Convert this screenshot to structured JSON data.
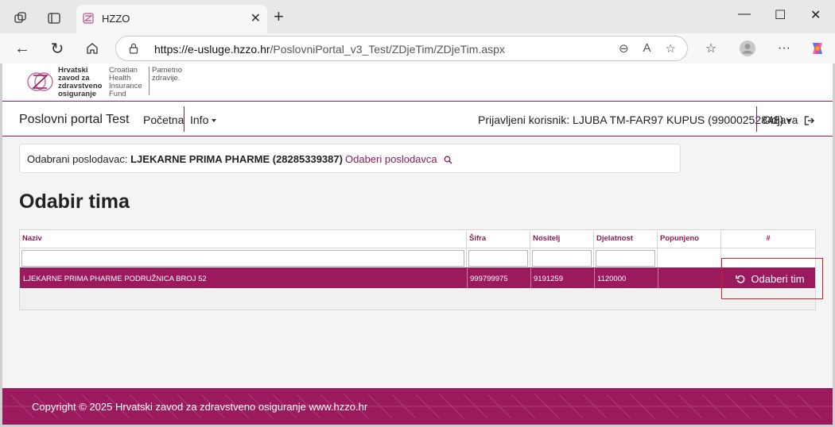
{
  "browser": {
    "tab_title": "HZZO",
    "url_domain": "https://e-usluge.hzzo.hr",
    "url_path": "/PoslovniPortal_v3_Test/ZDjeTim/ZDjeTim.aspx"
  },
  "logo": {
    "hr_lines": [
      "Hrvatski",
      "zavod za",
      "zdravstveno",
      "osiguranje"
    ],
    "en_lines": [
      "Croatian",
      "Health",
      "Insurance",
      "Fund"
    ],
    "slogan_lines": [
      "Pametno",
      "zdravije."
    ]
  },
  "menu": {
    "brand": "Poslovni portal Test",
    "home": "Početna",
    "info": "Info",
    "user": "Prijavljeni korisnik: LJUBA TM-FAR97 KUPUS (99000252848)",
    "logout": "Odjava"
  },
  "employer": {
    "label": "Odabrani poslodavac:",
    "name": "LJEKARNE PRIMA PHARME (28285339387)",
    "select_link": "Odaberi poslodavca"
  },
  "page_title": "Odabir tima",
  "table": {
    "headers": [
      "Naziv",
      "Šifra",
      "Nositelj",
      "Djelatnost",
      "Popunjeno",
      "#"
    ],
    "rows": [
      {
        "naziv": "LJEKARNE PRIMA PHARME PODRUŽNICA BROJ 52",
        "sifra": "999799975",
        "nositelj": "9191259",
        "djelatnost": "1120000",
        "popunjeno": ""
      }
    ],
    "row_button": "Odaberi tim"
  },
  "footer": "Copyright © 2025 Hrvatski zavod za zdravstveno osiguranje www.hzzo.hr",
  "colors": {
    "brand": "#9b1a5e",
    "highlight": "#c0262d"
  }
}
